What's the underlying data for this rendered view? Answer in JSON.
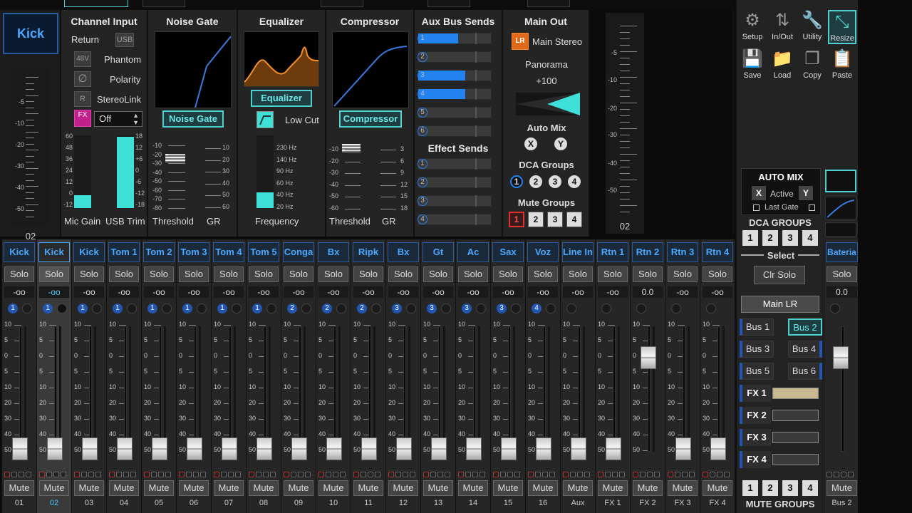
{
  "strip": {
    "name": "Kick",
    "channel_number": "02",
    "meter_scale": [
      "-5",
      "-10",
      "-20",
      "-30",
      "-40",
      "-50"
    ]
  },
  "channel_input": {
    "title": "Channel Input",
    "return_label": "Return",
    "usb_label": "USB",
    "phantom_btn": "48V",
    "phantom_label": "Phantom",
    "polarity_btn": "∅",
    "polarity_label": "Polarity",
    "stereolink_btn": "R",
    "stereolink_label": "StereoLink",
    "fx_btn": "FX",
    "fx_select_value": "Off",
    "left_scale": [
      "60",
      "48",
      "36",
      "24",
      "12",
      "0",
      "-12"
    ],
    "right_scale": [
      "18",
      "12",
      "+6",
      "0",
      "-6",
      "-12",
      "-18"
    ],
    "mic_gain_label": "Mic Gain",
    "usb_trim_label": "USB Trim",
    "mic_gain_level": 0.18,
    "usb_trim_level": 0.98
  },
  "noise_gate": {
    "title": "Noise Gate",
    "button": "Noise Gate",
    "threshold_scale": [
      "-10",
      "-20",
      "-30",
      "-40",
      "-50",
      "-60",
      "-70",
      "-80"
    ],
    "gr_scale": [
      "10",
      "20",
      "30",
      "40",
      "50",
      "60"
    ],
    "threshold_label": "Threshold",
    "gr_label": "GR"
  },
  "equalizer": {
    "title": "Equalizer",
    "button": "Equalizer",
    "lowcut_label": "Low Cut",
    "freq_scale": [
      "230 Hz",
      "140 Hz",
      "90 Hz",
      "60 Hz",
      "40 Hz",
      "20 Hz"
    ],
    "frequency_label": "Frequency"
  },
  "compressor": {
    "title": "Compressor",
    "button": "Compressor",
    "threshold_scale": [
      "-10",
      "-20",
      "-30",
      "-40",
      "-50",
      "-60"
    ],
    "gr_scale": [
      "3",
      "6",
      "9",
      "12",
      "15",
      "18"
    ],
    "threshold_label": "Threshold",
    "gr_label": "GR"
  },
  "aux_sends": {
    "title": "Aux Bus Sends",
    "sends": [
      {
        "num": "1",
        "level": 0.55
      },
      {
        "num": "2",
        "level": 0
      },
      {
        "num": "3",
        "level": 0.65
      },
      {
        "num": "4",
        "level": 0.65
      },
      {
        "num": "5",
        "level": 0
      },
      {
        "num": "6",
        "level": 0
      }
    ],
    "effect_title": "Effect Sends",
    "effects": [
      "1",
      "2",
      "3",
      "4"
    ]
  },
  "main_out": {
    "title": "Main Out",
    "lr_btn": "LR",
    "lr_label": "Main Stereo",
    "panorama_label": "Panorama",
    "panorama_value": "+100",
    "automix_label": "Auto Mix",
    "automix_x": "X",
    "automix_y": "Y",
    "dca_label": "DCA Groups",
    "dca": [
      "1",
      "2",
      "3",
      "4"
    ],
    "mute_label": "Mute Groups",
    "mute": [
      "1",
      "2",
      "3",
      "4"
    ]
  },
  "right_meter": {
    "number": "02",
    "scale": [
      "-5",
      "-10",
      "-20",
      "-30",
      "-40",
      "-50"
    ]
  },
  "channels": [
    {
      "name": "Kick",
      "db": "-oo",
      "dca": "1",
      "num": "01"
    },
    {
      "name": "Kick",
      "db": "-oo",
      "dca": "1",
      "num": "02"
    },
    {
      "name": "Kick",
      "db": "-oo",
      "dca": "1",
      "num": "03"
    },
    {
      "name": "Tom 1",
      "db": "-oo",
      "dca": "1",
      "num": "04"
    },
    {
      "name": "Tom 2",
      "db": "-oo",
      "dca": "1",
      "num": "05"
    },
    {
      "name": "Tom 3",
      "db": "-oo",
      "dca": "1",
      "num": "06"
    },
    {
      "name": "Tom 4",
      "db": "-oo",
      "dca": "1",
      "num": "07"
    },
    {
      "name": "Tom 5",
      "db": "-oo",
      "dca": "1",
      "num": "08"
    },
    {
      "name": "Conga",
      "db": "-oo",
      "dca": "2",
      "num": "09"
    },
    {
      "name": "Bx",
      "db": "-oo",
      "dca": "2",
      "num": "10"
    },
    {
      "name": "Ripk",
      "db": "-oo",
      "dca": "2",
      "num": "11"
    },
    {
      "name": "Bx",
      "db": "-oo",
      "dca": "3",
      "num": "12"
    },
    {
      "name": "Gt",
      "db": "-oo",
      "dca": "3",
      "num": "13"
    },
    {
      "name": "Ac",
      "db": "-oo",
      "dca": "3",
      "num": "14"
    },
    {
      "name": "Sax",
      "db": "-oo",
      "dca": "3",
      "num": "15"
    },
    {
      "name": "Voz",
      "db": "-oo",
      "dca": "4",
      "num": "16"
    },
    {
      "name": "Line In",
      "db": "-oo",
      "dca": "",
      "num": "Aux"
    },
    {
      "name": "Rtn 1",
      "db": "-oo",
      "dca": "",
      "num": "FX 1"
    },
    {
      "name": "Rtn 2",
      "db": "0.0",
      "dca": "",
      "num": "FX 2"
    },
    {
      "name": "Rtn 3",
      "db": "-oo",
      "dca": "",
      "num": "FX 3"
    },
    {
      "name": "Rtn 4",
      "db": "-oo",
      "dca": "",
      "num": "FX 4"
    }
  ],
  "strip_labels": {
    "solo": "Solo",
    "mute": "Mute"
  },
  "fader_scale": [
    "10",
    "5",
    "0",
    "5",
    "10",
    "20",
    "30",
    "40",
    "50"
  ],
  "tools": [
    {
      "label": "Setup",
      "icon": "gear-icon",
      "glyph": "⚙"
    },
    {
      "label": "In/Out",
      "icon": "in-out-icon",
      "glyph": "⇅"
    },
    {
      "label": "Utility",
      "icon": "wrench-icon",
      "glyph": "🔧"
    },
    {
      "label": "Resize",
      "icon": "resize-icon",
      "glyph": "⤡"
    },
    {
      "label": "Save",
      "icon": "save-icon",
      "glyph": "💾"
    },
    {
      "label": "Load",
      "icon": "folder-icon",
      "glyph": "📁"
    },
    {
      "label": "Copy",
      "icon": "copy-icon",
      "glyph": "❐"
    },
    {
      "label": "Paste",
      "icon": "paste-icon",
      "glyph": "📋"
    }
  ],
  "automix_panel": {
    "title": "AUTO MIX",
    "x": "X",
    "active": "Active",
    "y": "Y",
    "last_gate": "Last Gate"
  },
  "dca_groups_panel": {
    "title": "DCA GROUPS",
    "buttons": [
      "1",
      "2",
      "3",
      "4"
    ],
    "select_label": "Select",
    "clr_solo": "Clr Solo"
  },
  "main_lr": "Main LR",
  "buses": [
    "Bus 1",
    "Bus 2",
    "Bus 3",
    "Bus 4",
    "Bus 5",
    "Bus 6"
  ],
  "fx": [
    "FX 1",
    "FX 2",
    "FX 3",
    "FX 4"
  ],
  "mute_groups_panel": {
    "buttons": [
      "1",
      "2",
      "3",
      "4"
    ],
    "title": "MUTE GROUPS"
  },
  "bus_strip": {
    "name": "Bateria",
    "solo": "Solo",
    "db": "0.0",
    "mute": "Mute",
    "num": "Bus 2"
  }
}
